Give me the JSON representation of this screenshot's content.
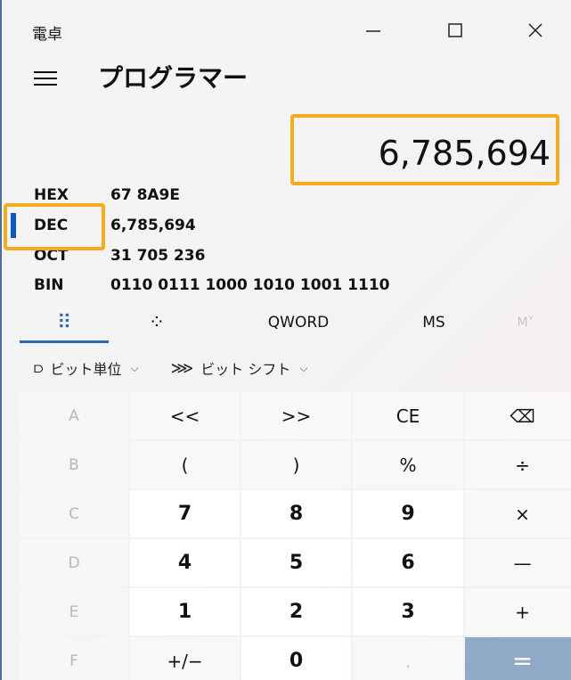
{
  "window": {
    "title": "電卓",
    "minimize_icon": "—",
    "maximize_icon": "☐",
    "close_icon": "✕"
  },
  "header": {
    "mode_title": "プログラマー"
  },
  "display": {
    "value": "6,785,694"
  },
  "radix": [
    {
      "label": "HEX",
      "value": "67 8A9E"
    },
    {
      "label": "DEC",
      "value": "6,785,694"
    },
    {
      "label": "OCT",
      "value": "31 705 236"
    },
    {
      "label": "BIN",
      "value": "0110 0111 1000 1010 1001 1110"
    }
  ],
  "tabs": {
    "keypad_icon": "⠿",
    "bit_toggle_icon": "⁘",
    "word_size": "QWORD",
    "memory_store": "MS",
    "memory_menu": "M˅"
  },
  "bit_tools": {
    "bitwise_label": "ビット単位",
    "bitwise_icon": "⫐",
    "bitshift_label": "ビット シフト",
    "bitshift_icon": "⋙",
    "chevron": "⌵"
  },
  "keys": [
    [
      "A",
      "<<",
      ">>",
      "CE",
      "⌫"
    ],
    [
      "B",
      "(",
      ")",
      "%",
      "÷"
    ],
    [
      "C",
      "7",
      "8",
      "9",
      "×"
    ],
    [
      "D",
      "4",
      "5",
      "6",
      "—"
    ],
    [
      "E",
      "1",
      "2",
      "3",
      "+"
    ],
    [
      "F",
      "+/−",
      "0",
      ".",
      "="
    ]
  ],
  "colors": {
    "accent": "#2f68b5",
    "highlight": "#f5ac1a",
    "equals_bg": "#8fa9c7"
  }
}
